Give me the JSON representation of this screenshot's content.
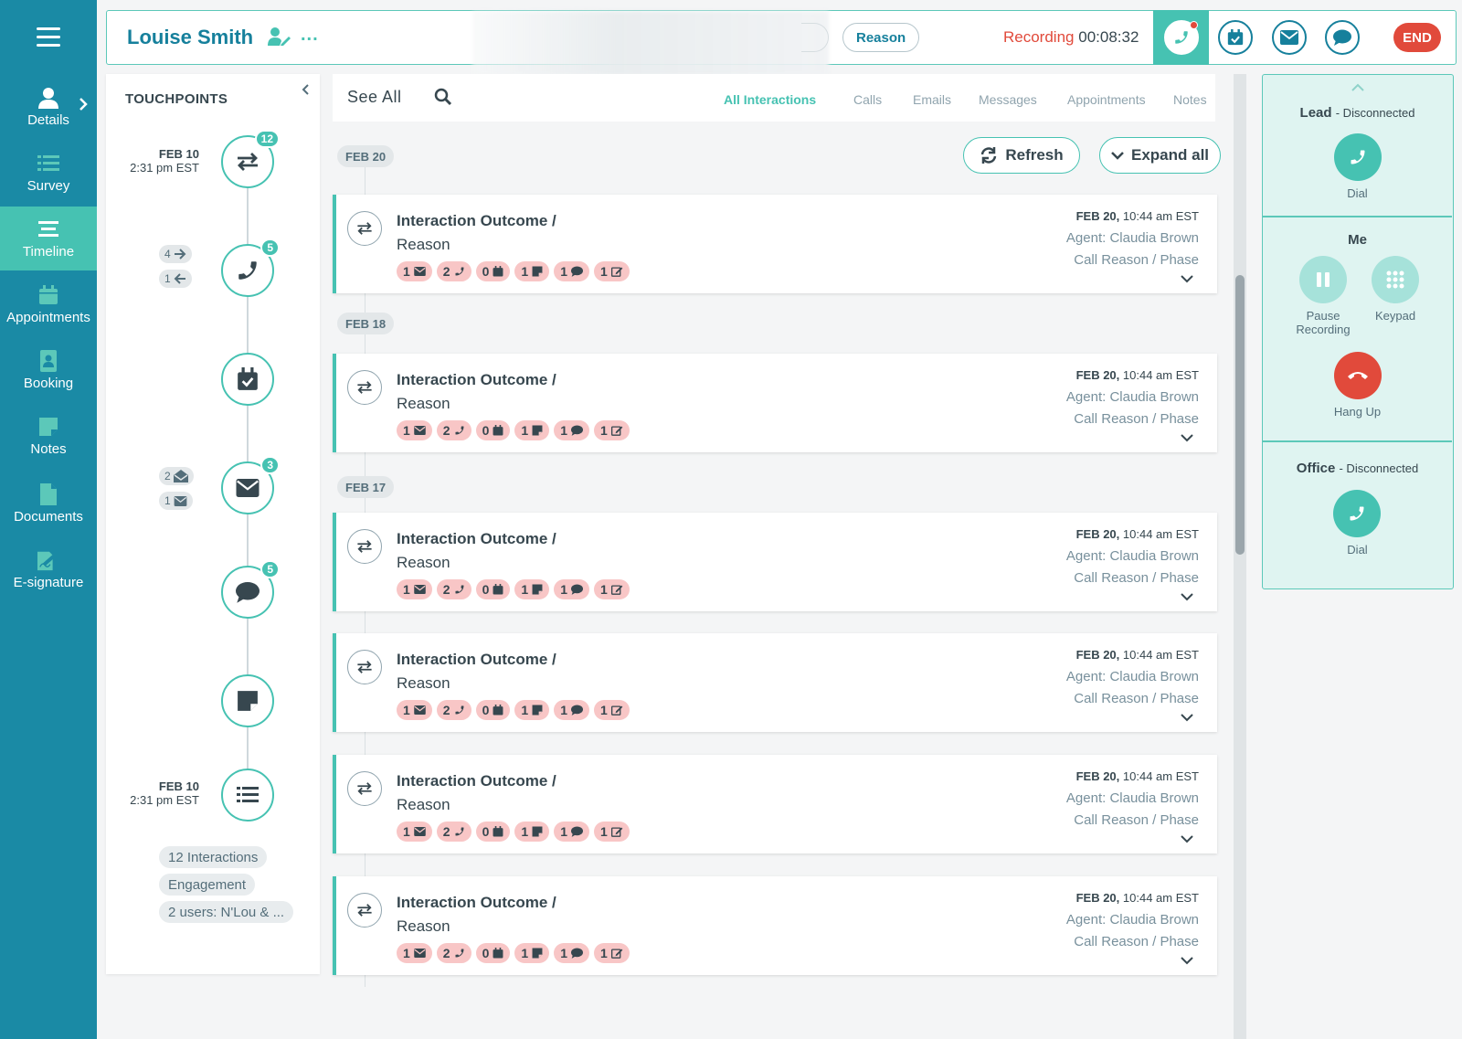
{
  "nav": {
    "items": [
      {
        "label": "Details",
        "icon": "user-icon"
      },
      {
        "label": "Survey",
        "icon": "list-icon"
      },
      {
        "label": "Timeline",
        "icon": "timeline-icon",
        "active": true
      },
      {
        "label": "Appointments",
        "icon": "calendar-icon"
      },
      {
        "label": "Booking",
        "icon": "address-book-icon"
      },
      {
        "label": "Notes",
        "icon": "note-icon"
      },
      {
        "label": "Documents",
        "icon": "document-icon"
      },
      {
        "label": "E-signature",
        "icon": "signature-icon"
      }
    ]
  },
  "header": {
    "lead_name": "Louise Smith",
    "more": "...",
    "reason": "Reason",
    "recording_label": "Recording",
    "recording_time": "00:08:32",
    "end_label": "END"
  },
  "touchpoints": {
    "title": "TOUCHPOINTS",
    "first_date": "FEB 10",
    "first_time": "2:31 pm EST",
    "last_date": "FEB 10",
    "last_time": "2:31 pm EST",
    "interactions_badge": "12",
    "calls_badge": "5",
    "emails_badge": "3",
    "messages_badge": "5",
    "calls_out": "4",
    "calls_in": "1",
    "emails_opened": "2",
    "emails_unopened": "1",
    "tags": [
      "12 Interactions",
      "Engagement",
      "2 users: N'Lou & ..."
    ]
  },
  "filter": {
    "see_all": "See All",
    "tabs": [
      "All Interactions",
      "Calls",
      "Emails",
      "Messages",
      "Appointments",
      "Notes"
    ],
    "active_tab": "All Interactions"
  },
  "actions": {
    "refresh": "Refresh",
    "expand_all": "Expand all"
  },
  "date_groups": [
    "FEB 20",
    "FEB 18",
    "FEB 17"
  ],
  "interactions": [
    {
      "title": "Interaction Outcome /",
      "subtitle": "Reason",
      "date": "FEB 20,",
      "time": "10:44 am EST",
      "agent": "Agent: Claudia Brown",
      "phase": "Call Reason / Phase",
      "counts": [
        "1",
        "2",
        "0",
        "1",
        "1",
        "1"
      ]
    },
    {
      "title": "Interaction Outcome /",
      "subtitle": "Reason",
      "date": "FEB 20,",
      "time": "10:44 am EST",
      "agent": "Agent: Claudia Brown",
      "phase": "Call Reason / Phase",
      "counts": [
        "1",
        "2",
        "0",
        "1",
        "1",
        "1"
      ]
    },
    {
      "title": "Interaction Outcome /",
      "subtitle": "Reason",
      "date": "FEB 20,",
      "time": "10:44 am EST",
      "agent": "Agent: Claudia Brown",
      "phase": "Call Reason / Phase",
      "counts": [
        "1",
        "2",
        "0",
        "1",
        "1",
        "1"
      ]
    },
    {
      "title": "Interaction Outcome /",
      "subtitle": "Reason",
      "date": "FEB 20,",
      "time": "10:44 am EST",
      "agent": "Agent: Claudia Brown",
      "phase": "Call Reason / Phase",
      "counts": [
        "1",
        "2",
        "0",
        "1",
        "1",
        "1"
      ]
    },
    {
      "title": "Interaction Outcome /",
      "subtitle": "Reason",
      "date": "FEB 20,",
      "time": "10:44 am EST",
      "agent": "Agent: Claudia Brown",
      "phase": "Call Reason / Phase",
      "counts": [
        "1",
        "2",
        "0",
        "1",
        "1",
        "1"
      ]
    },
    {
      "title": "Interaction Outcome /",
      "subtitle": "Reason",
      "date": "FEB 20,",
      "time": "10:44 am EST",
      "agent": "Agent: Claudia Brown",
      "phase": "Call Reason / Phase",
      "counts": [
        "1",
        "2",
        "0",
        "1",
        "1",
        "1"
      ]
    }
  ],
  "dialer": {
    "lead_label": "Lead",
    "lead_status": "- Disconnected",
    "dial": "Dial",
    "me_label": "Me",
    "pause": "Pause Recording",
    "keypad": "Keypad",
    "hang_up": "Hang Up",
    "office_label": "Office",
    "office_status": "- Disconnected",
    "office_dial": "Dial"
  },
  "colors": {
    "nav_bg": "#1a8aa5",
    "accent": "#46c2b2",
    "danger": "#e14a3b",
    "chip": "#f8c6c6"
  }
}
